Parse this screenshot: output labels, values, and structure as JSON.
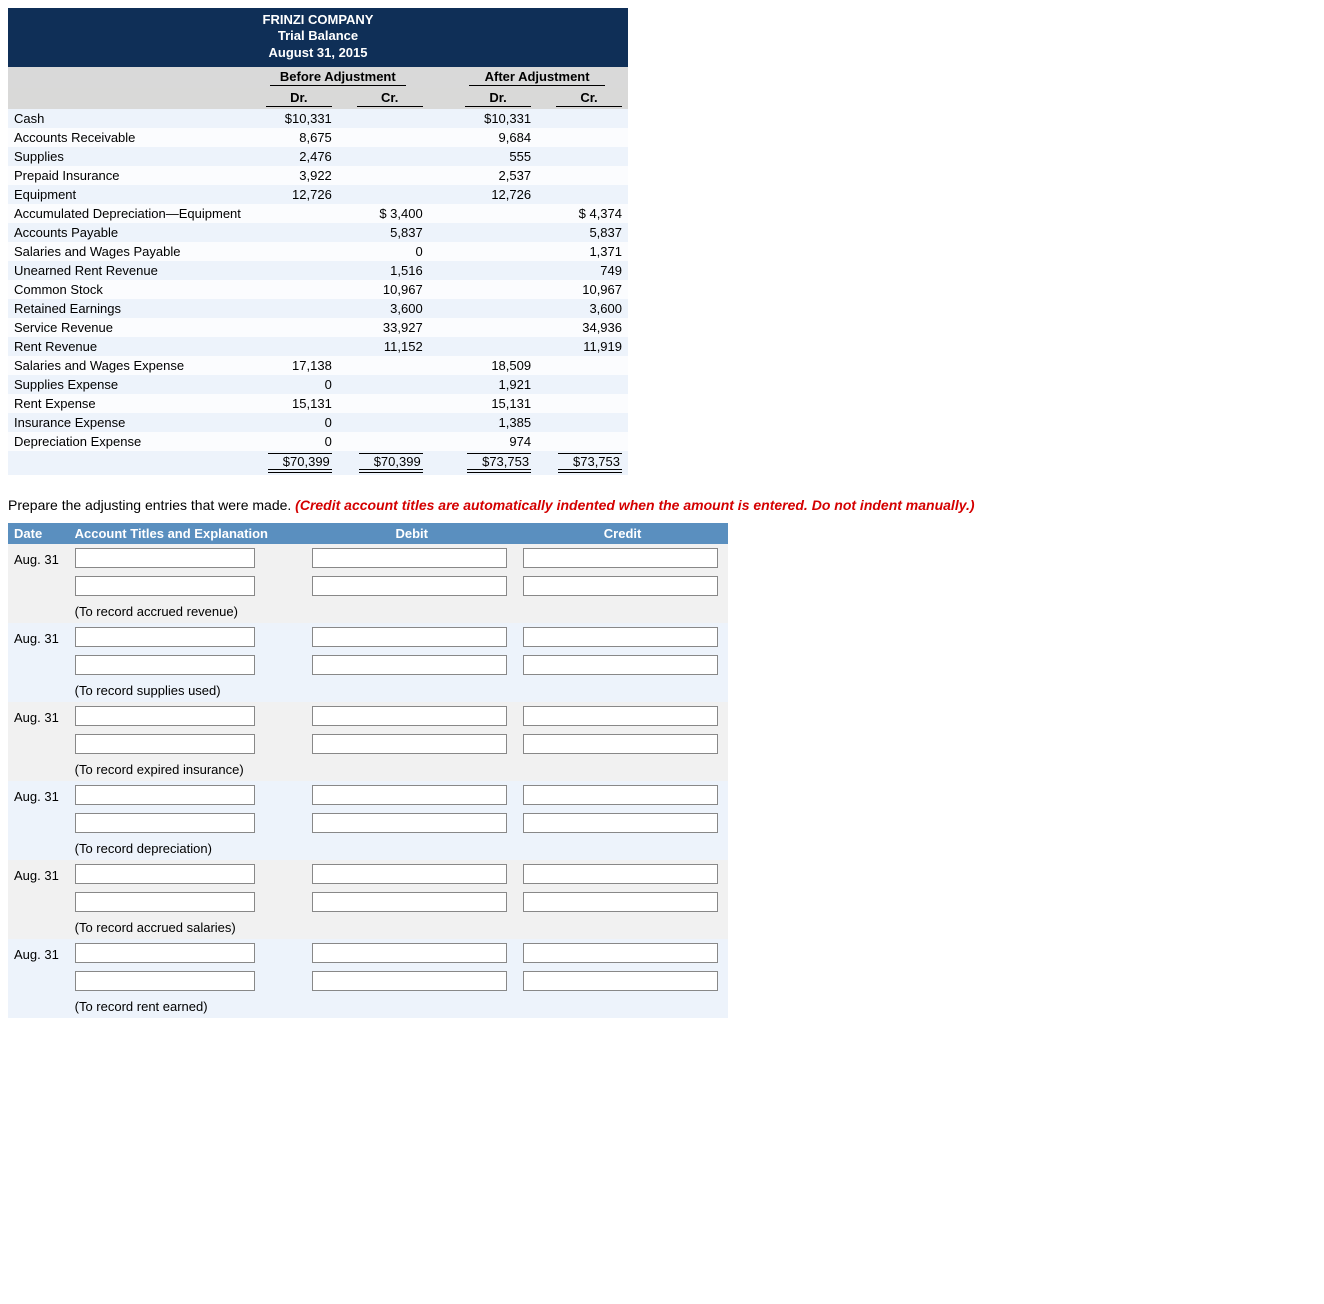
{
  "trial_balance": {
    "company": "FRINZI COMPANY",
    "report": "Trial Balance",
    "date": "August 31, 2015",
    "group_before": "Before Adjustment",
    "group_after": "After Adjustment",
    "dr_label": "Dr.",
    "cr_label": "Cr.",
    "rows": [
      {
        "acct": "Cash",
        "b_dr": "$10,331",
        "b_cr": "",
        "a_dr": "$10,331",
        "a_cr": ""
      },
      {
        "acct": "Accounts Receivable",
        "b_dr": "8,675",
        "b_cr": "",
        "a_dr": "9,684",
        "a_cr": ""
      },
      {
        "acct": "Supplies",
        "b_dr": "2,476",
        "b_cr": "",
        "a_dr": "555",
        "a_cr": ""
      },
      {
        "acct": "Prepaid Insurance",
        "b_dr": "3,922",
        "b_cr": "",
        "a_dr": "2,537",
        "a_cr": ""
      },
      {
        "acct": "Equipment",
        "b_dr": "12,726",
        "b_cr": "",
        "a_dr": "12,726",
        "a_cr": ""
      },
      {
        "acct": "Accumulated Depreciation—Equipment",
        "b_dr": "",
        "b_cr": "$ 3,400",
        "a_dr": "",
        "a_cr": "$ 4,374"
      },
      {
        "acct": "Accounts Payable",
        "b_dr": "",
        "b_cr": "5,837",
        "a_dr": "",
        "a_cr": "5,837"
      },
      {
        "acct": "Salaries and Wages Payable",
        "b_dr": "",
        "b_cr": "0",
        "a_dr": "",
        "a_cr": "1,371"
      },
      {
        "acct": "Unearned Rent Revenue",
        "b_dr": "",
        "b_cr": "1,516",
        "a_dr": "",
        "a_cr": "749"
      },
      {
        "acct": "Common Stock",
        "b_dr": "",
        "b_cr": "10,967",
        "a_dr": "",
        "a_cr": "10,967"
      },
      {
        "acct": "Retained Earnings",
        "b_dr": "",
        "b_cr": "3,600",
        "a_dr": "",
        "a_cr": "3,600"
      },
      {
        "acct": "Service Revenue",
        "b_dr": "",
        "b_cr": "33,927",
        "a_dr": "",
        "a_cr": "34,936"
      },
      {
        "acct": "Rent Revenue",
        "b_dr": "",
        "b_cr": "11,152",
        "a_dr": "",
        "a_cr": "11,919"
      },
      {
        "acct": "Salaries and Wages Expense",
        "b_dr": "17,138",
        "b_cr": "",
        "a_dr": "18,509",
        "a_cr": ""
      },
      {
        "acct": "Supplies Expense",
        "b_dr": "0",
        "b_cr": "",
        "a_dr": "1,921",
        "a_cr": ""
      },
      {
        "acct": "Rent Expense",
        "b_dr": "15,131",
        "b_cr": "",
        "a_dr": "15,131",
        "a_cr": ""
      },
      {
        "acct": "Insurance Expense",
        "b_dr": "0",
        "b_cr": "",
        "a_dr": "1,385",
        "a_cr": ""
      },
      {
        "acct": "Depreciation Expense",
        "b_dr": "0",
        "b_cr": "",
        "a_dr": "974",
        "a_cr": ""
      }
    ],
    "totals": {
      "b_dr": "$70,399",
      "b_cr": "$70,399",
      "a_dr": "$73,753",
      "a_cr": "$73,753"
    }
  },
  "instruction": {
    "text": "Prepare the adjusting entries that were made. ",
    "hint": "(Credit account titles are automatically indented when the amount is entered. Do not indent manually.)"
  },
  "journal": {
    "headers": {
      "date": "Date",
      "title": "Account Titles and Explanation",
      "debit": "Debit",
      "credit": "Credit"
    },
    "entries": [
      {
        "date": "Aug. 31",
        "explanation": "(To record accrued revenue)"
      },
      {
        "date": "Aug. 31",
        "explanation": "(To record supplies used)"
      },
      {
        "date": "Aug. 31",
        "explanation": "(To record expired insurance)"
      },
      {
        "date": "Aug. 31",
        "explanation": "(To record depreciation)"
      },
      {
        "date": "Aug. 31",
        "explanation": "(To record accrued salaries)"
      },
      {
        "date": "Aug. 31",
        "explanation": "(To record rent earned)"
      }
    ]
  }
}
